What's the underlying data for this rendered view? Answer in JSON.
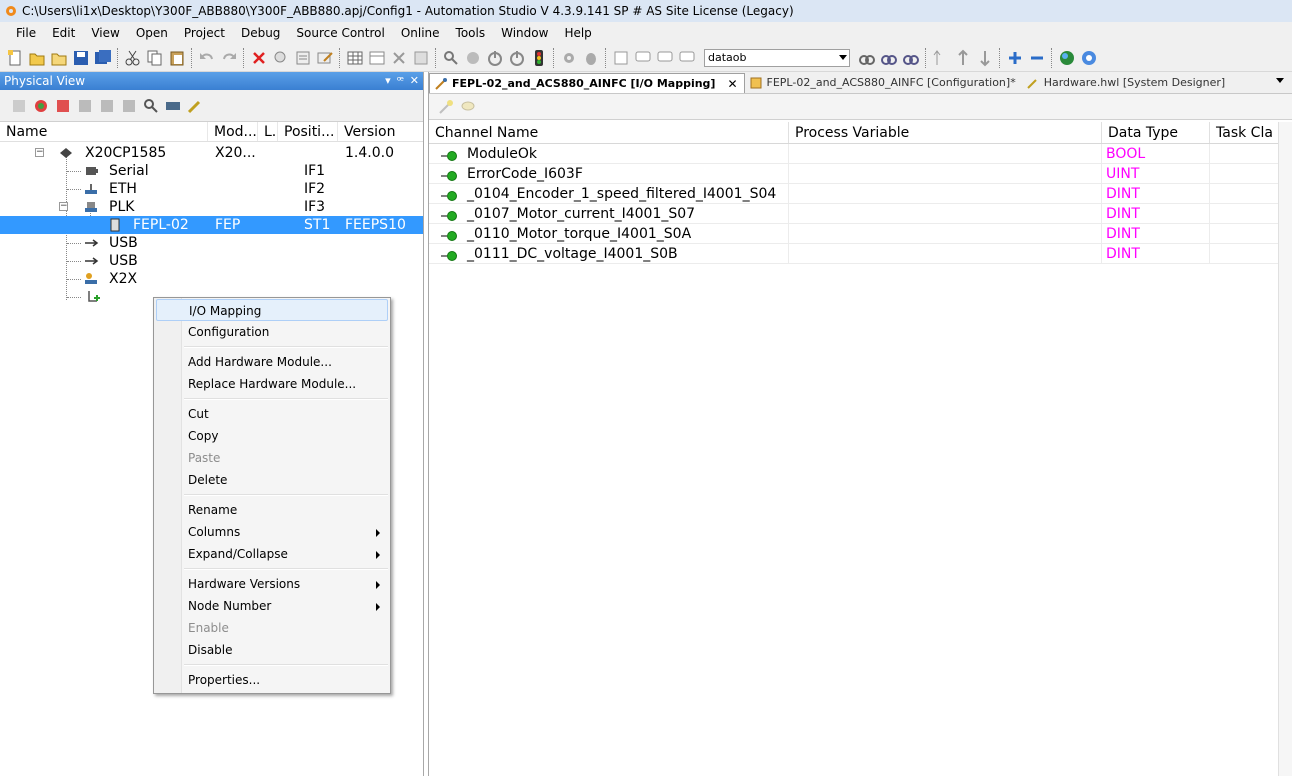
{
  "window": {
    "title": "C:\\Users\\li1x\\Desktop\\Y300F_ABB880\\Y300F_ABB880.apj/Config1 - Automation Studio V 4.3.9.141 SP # AS Site License (Legacy)"
  },
  "menu": [
    "File",
    "Edit",
    "View",
    "Open",
    "Project",
    "Debug",
    "Source Control",
    "Online",
    "Tools",
    "Window",
    "Help"
  ],
  "toolbar": {
    "combo_value": "dataob"
  },
  "physical_view": {
    "title": "Physical View",
    "columns": [
      "Name",
      "Mod...",
      "L.",
      "Positi...",
      "Version"
    ],
    "rows": [
      {
        "name": "X20CP1585",
        "module": "X20...",
        "position": "",
        "version": "1.4.0.0"
      },
      {
        "name": "Serial",
        "module": "",
        "position": "IF1",
        "version": ""
      },
      {
        "name": "ETH",
        "module": "",
        "position": "IF2",
        "version": ""
      },
      {
        "name": "PLK",
        "module": "",
        "position": "IF3",
        "version": ""
      },
      {
        "name": "FEPL-02",
        "module": "FEP",
        "position": "ST1",
        "version": "FEEPS10"
      },
      {
        "name": "USB",
        "module": "",
        "position": "",
        "version": ""
      },
      {
        "name": "USB",
        "module": "",
        "position": "",
        "version": ""
      },
      {
        "name": "X2X",
        "module": "",
        "position": "",
        "version": ""
      }
    ]
  },
  "context_menu": [
    {
      "label": "I/O Mapping",
      "highlight": true
    },
    {
      "label": "Configuration"
    },
    {
      "sep": true
    },
    {
      "label": "Add Hardware Module..."
    },
    {
      "label": "Replace Hardware Module..."
    },
    {
      "sep": true
    },
    {
      "label": "Cut"
    },
    {
      "label": "Copy"
    },
    {
      "label": "Paste",
      "disabled": true
    },
    {
      "label": "Delete"
    },
    {
      "sep": true
    },
    {
      "label": "Rename"
    },
    {
      "label": "Columns",
      "submenu": true
    },
    {
      "label": "Expand/Collapse",
      "submenu": true
    },
    {
      "sep": true
    },
    {
      "label": "Hardware Versions",
      "submenu": true
    },
    {
      "label": "Node Number",
      "submenu": true
    },
    {
      "label": "Enable",
      "disabled": true
    },
    {
      "label": "Disable"
    },
    {
      "sep": true
    },
    {
      "label": "Properties..."
    }
  ],
  "tabs": [
    {
      "label": "FEPL-02_and_ACS880_AINFC [I/O Mapping]",
      "active": true
    },
    {
      "label": "FEPL-02_and_ACS880_AINFC [Configuration]*"
    },
    {
      "label": "Hardware.hwl [System Designer]"
    }
  ],
  "io_mapping": {
    "columns": [
      "Channel Name",
      "Process Variable",
      "Data Type",
      "Task Cla"
    ],
    "rows": [
      {
        "channel": "ModuleOk",
        "variable": "",
        "type": "BOOL"
      },
      {
        "channel": "ErrorCode_I603F",
        "variable": "",
        "type": "UINT"
      },
      {
        "channel": "_0104_Encoder_1_speed_filtered_I4001_S04",
        "variable": "",
        "type": "DINT"
      },
      {
        "channel": "_0107_Motor_current_I4001_S07",
        "variable": "",
        "type": "DINT"
      },
      {
        "channel": "_0110_Motor_torque_I4001_S0A",
        "variable": "",
        "type": "DINT"
      },
      {
        "channel": "_0111_DC_voltage_I4001_S0B",
        "variable": "",
        "type": "DINT"
      }
    ]
  },
  "colors": {
    "datatype": "#ff00ff",
    "selection": "#3399ff",
    "panel_header": "#3a7fd2",
    "channel_led": "#22aa22"
  }
}
